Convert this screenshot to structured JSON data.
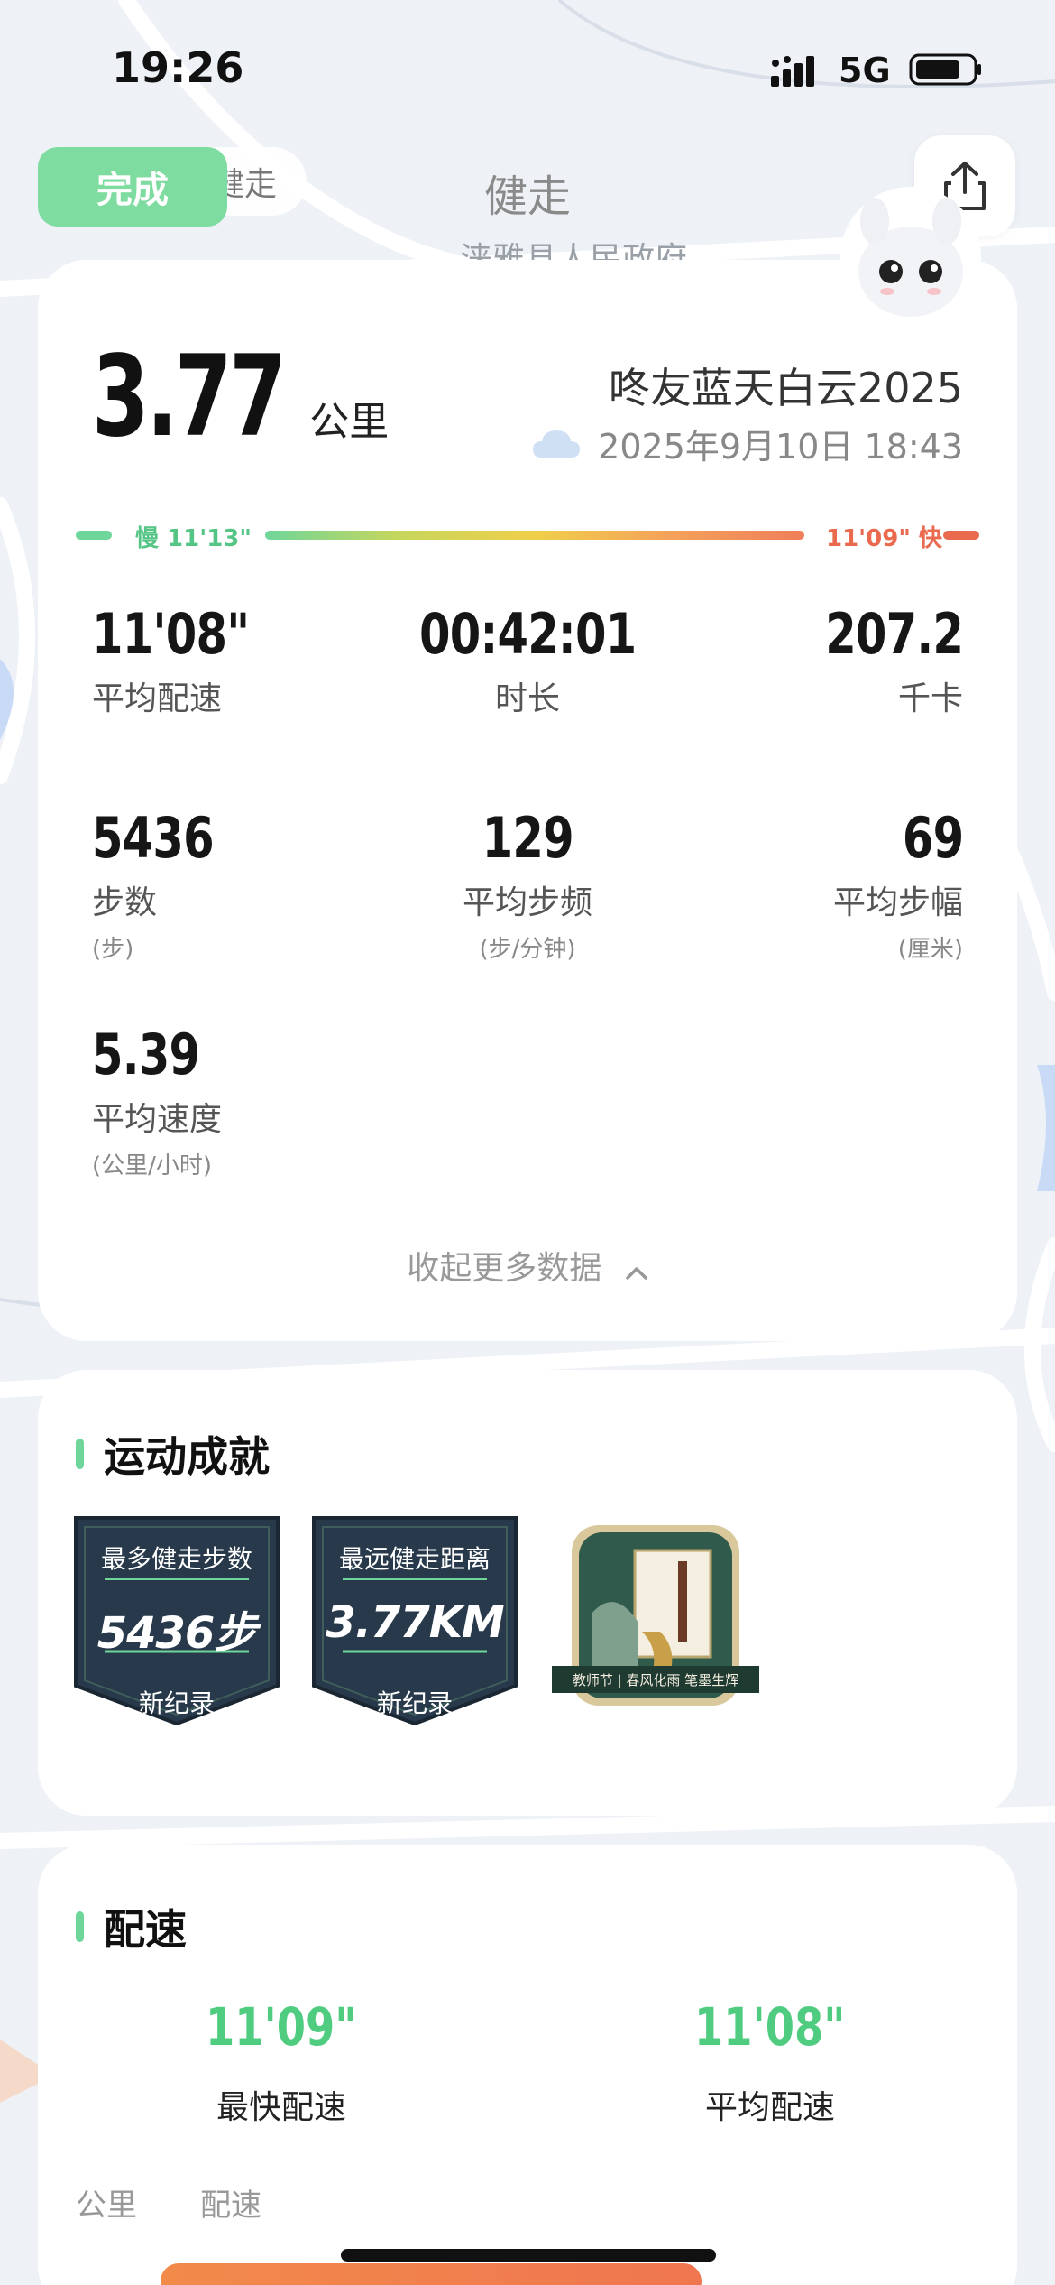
{
  "status_bar": {
    "time": "19:26",
    "network": "5G"
  },
  "header": {
    "done_label": "完成",
    "mini_label": "健走",
    "title": "健走"
  },
  "map_label": "涞雅县人民政府",
  "summary": {
    "distance": "3.77",
    "distance_unit": "公里",
    "title": "咚友蓝天白云2025",
    "date": "2025年9月10日 18:43",
    "weather_icon": "cloud-icon"
  },
  "pace_bar": {
    "slow_label": "慢 11'13\"",
    "fast_label": "11'09\" 快",
    "colors": {
      "slow": "#6ed69a",
      "fast": "#ea6a4f"
    }
  },
  "stats": {
    "avg_pace": {
      "value": "11'08\"",
      "label": "平均配速"
    },
    "duration": {
      "value": "00:42:01",
      "label": "时长"
    },
    "calories": {
      "value": "207.2",
      "label": "千卡"
    },
    "steps": {
      "value": "5436",
      "label": "步数",
      "sub": "(步)"
    },
    "cadence": {
      "value": "129",
      "label": "平均步频",
      "sub": "(步/分钟)"
    },
    "stride": {
      "value": "69",
      "label": "平均步幅",
      "sub": "(厘米)"
    },
    "speed": {
      "value": "5.39",
      "label": "平均速度",
      "sub": "(公里/小时)"
    }
  },
  "collapse_label": "收起更多数据",
  "achievements": {
    "title": "运动成就",
    "badges": [
      {
        "title": "最多健走步数",
        "value": "5436步",
        "note": "新纪录"
      },
      {
        "title": "最远健走距离",
        "value": "3.77KM",
        "note": "新纪录"
      },
      {
        "ribbon": "教师节 | 春风化雨 笔墨生辉"
      }
    ]
  },
  "pace": {
    "title": "配速",
    "fastest": {
      "value": "11'09\"",
      "label": "最快配速"
    },
    "average": {
      "value": "11'08\"",
      "label": "平均配速"
    },
    "columns": [
      "公里",
      "配速"
    ]
  }
}
